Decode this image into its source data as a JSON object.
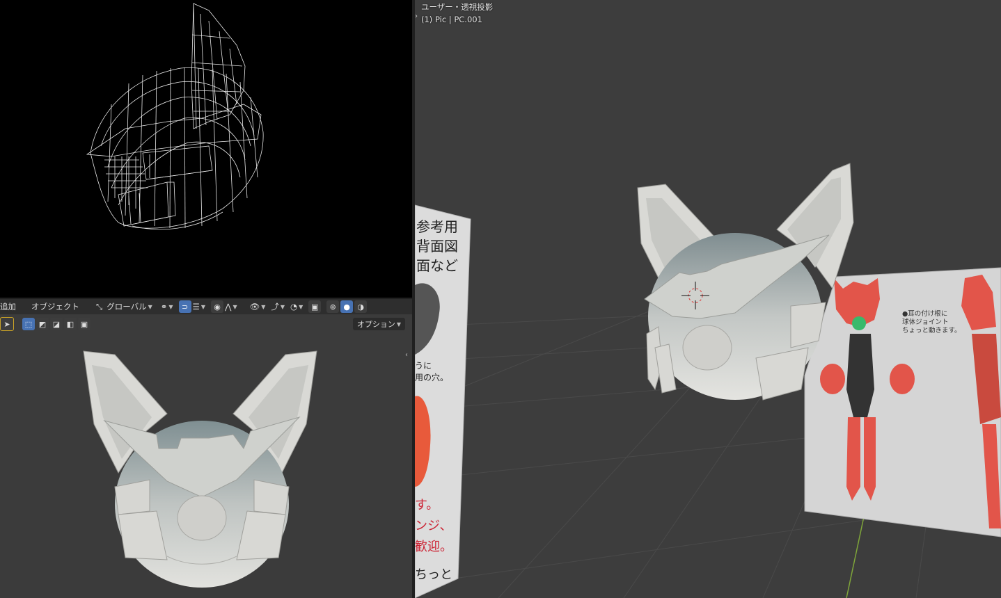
{
  "left_top_viewport": {
    "mode": "wireframe"
  },
  "header_bl": {
    "menu_add": "追加",
    "menu_object": "オブジェクト",
    "transform_orientation": "グローバル",
    "options_label": "オプション"
  },
  "right_viewport": {
    "view_label": "ユーザー・透視投影",
    "object_label": "(1) Pic | PC.001"
  },
  "ref_left": {
    "line1": "参考用",
    "line2": "背面図",
    "line3": "面など",
    "note1": "うに",
    "note2": "用の穴。",
    "note3": "す。",
    "note4": "ンジ、",
    "note5": "歓迎。",
    "note6": "ちっと"
  },
  "ref_right": {
    "annot1": "●耳の付け根に",
    "annot2": "球体ジョイント",
    "annot3": "ちょっと動きます。"
  },
  "colors": {
    "accent": "#4772b3",
    "viewport_bg": "#3d3d3d",
    "wire_bg": "#000000"
  }
}
